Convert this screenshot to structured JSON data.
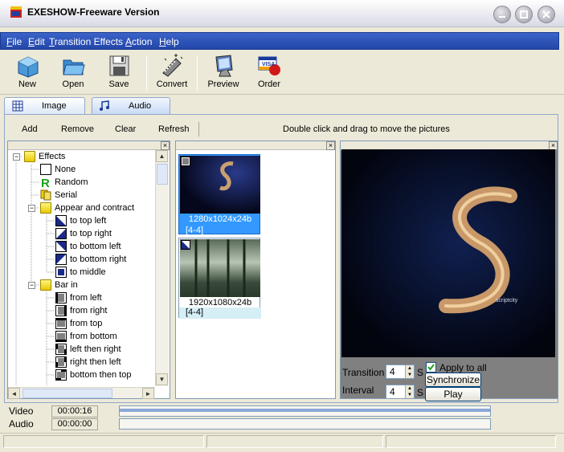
{
  "window": {
    "title": "EXESHOW-Freeware Version"
  },
  "menu": [
    {
      "label": "File",
      "ul": "F",
      "rest": "ile"
    },
    {
      "label": "Edit",
      "ul": "E",
      "rest": "dit"
    },
    {
      "label": "Transition Effects",
      "ul": "T",
      "rest": "ransition Effects"
    },
    {
      "label": "Action",
      "ul": "A",
      "rest": "ction"
    },
    {
      "label": "Help",
      "ul": "H",
      "rest": "elp"
    }
  ],
  "toolbar": {
    "new": "New",
    "open": "Open",
    "save": "Save",
    "convert": "Convert",
    "preview": "Preview",
    "order": "Order"
  },
  "tabs": {
    "image": "Image",
    "audio": "Audio"
  },
  "subtoolbar": {
    "add": "Add",
    "remove": "Remove",
    "clear": "Clear",
    "refresh": "Refresh",
    "hint": "Double click and drag to move the pictures"
  },
  "tree": {
    "root": "Effects",
    "items": [
      "None",
      "Random",
      "Serial"
    ],
    "appear": {
      "label": "Appear and contract",
      "children": [
        "to top left",
        "to top right",
        "to bottom left",
        "to bottom right",
        "to middle"
      ]
    },
    "barin": {
      "label": "Bar in",
      "children": [
        "from left",
        "from right",
        "from top",
        "from bottom",
        "left then right",
        "right then left",
        "bottom then top"
      ]
    }
  },
  "thumbnails": [
    {
      "caption": "1280x1024x24b",
      "range": "[4-4]"
    },
    {
      "caption": "1920x1080x24b",
      "range": "[4-4]"
    }
  ],
  "controls": {
    "transition_label": "Transition",
    "transition_value": "4",
    "transition_unit": "S",
    "interval_label": "Interval",
    "interval_value": "4",
    "interval_unit": "S",
    "apply_all": "Apply to all",
    "synchronize": "Synchronize",
    "play": "Play"
  },
  "timeline": {
    "video_label": "Video",
    "video_time": "00:00:16",
    "audio_label": "Audio",
    "audio_time": "00:00:00"
  },
  "colors": {
    "menubar": "#2a4fb4",
    "selection": "#3399ff",
    "preview_bg": "#0a0f2a"
  }
}
